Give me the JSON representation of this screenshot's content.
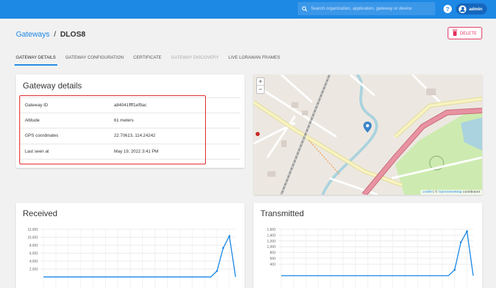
{
  "topbar": {
    "search_placeholder": "Search organization, application, gateway or device",
    "user_name": "admin",
    "help_glyph": "?",
    "color": "#1e88e5"
  },
  "breadcrumb": {
    "parent": "Gateways",
    "separator": "/",
    "current": "DLOS8"
  },
  "actions": {
    "delete_label": "DELETE",
    "delete_color": "#e5335d"
  },
  "tabs": [
    {
      "label": "GATEWAY DETAILS",
      "active": true
    },
    {
      "label": "GATEWAY CONFIGURATION",
      "active": false
    },
    {
      "label": "CERTIFICATE",
      "active": false
    },
    {
      "label": "GATEWAY DISCOVERY",
      "active": false,
      "disabled": true
    },
    {
      "label": "LIVE LORAWAN FRAMES",
      "active": false
    }
  ],
  "details": {
    "title": "Gateway details",
    "rows": [
      {
        "key": "Gateway ID",
        "value": "a84041ffff1ef9ac"
      },
      {
        "key": "Altitude",
        "value": "61 meters"
      },
      {
        "key": "GPS coordinates",
        "value": "22.70613, 114.24242"
      },
      {
        "key": "Last seen at",
        "value": "May 19, 2022 3:41 PM"
      }
    ]
  },
  "map": {
    "zoom_in": "+",
    "zoom_out": "−",
    "attribution_leaflet": "Leaflet",
    "attribution_sep": " | © ",
    "attribution_osm": "OpenStreetMap",
    "attribution_suffix": " contributors",
    "marker_icon": "map-pin-icon"
  },
  "charts": {
    "received": {
      "title": "Received"
    },
    "transmitted": {
      "title": "Transmitted"
    }
  },
  "chart_data": [
    {
      "type": "line",
      "title": "Received",
      "y_ticks": [
        "12,000",
        "10,000",
        "8,000",
        "6,000",
        "4,000",
        "2,000"
      ],
      "ylim": [
        0,
        12000
      ],
      "grid": true,
      "series": [
        {
          "values": [
            0,
            0,
            0,
            0,
            0,
            0,
            0,
            0,
            0,
            0,
            0,
            0,
            0,
            0,
            0,
            0,
            0,
            0,
            0,
            0,
            0,
            0,
            0,
            0,
            0,
            0,
            0,
            0,
            1500,
            7300,
            10300,
            0
          ]
        }
      ],
      "color": "#1e88e5"
    },
    {
      "type": "line",
      "title": "Transmitted",
      "y_ticks": [
        "1,600",
        "1,400",
        "1,200",
        "1,000",
        "800",
        "600",
        "400"
      ],
      "ylim": [
        0,
        1600
      ],
      "grid": true,
      "series": [
        {
          "values": [
            0,
            0,
            0,
            0,
            0,
            0,
            0,
            0,
            0,
            0,
            0,
            0,
            0,
            0,
            0,
            0,
            0,
            0,
            0,
            0,
            0,
            0,
            0,
            0,
            0,
            0,
            0,
            0,
            200,
            1150,
            1530,
            0
          ]
        }
      ],
      "color": "#1e88e5"
    }
  ]
}
